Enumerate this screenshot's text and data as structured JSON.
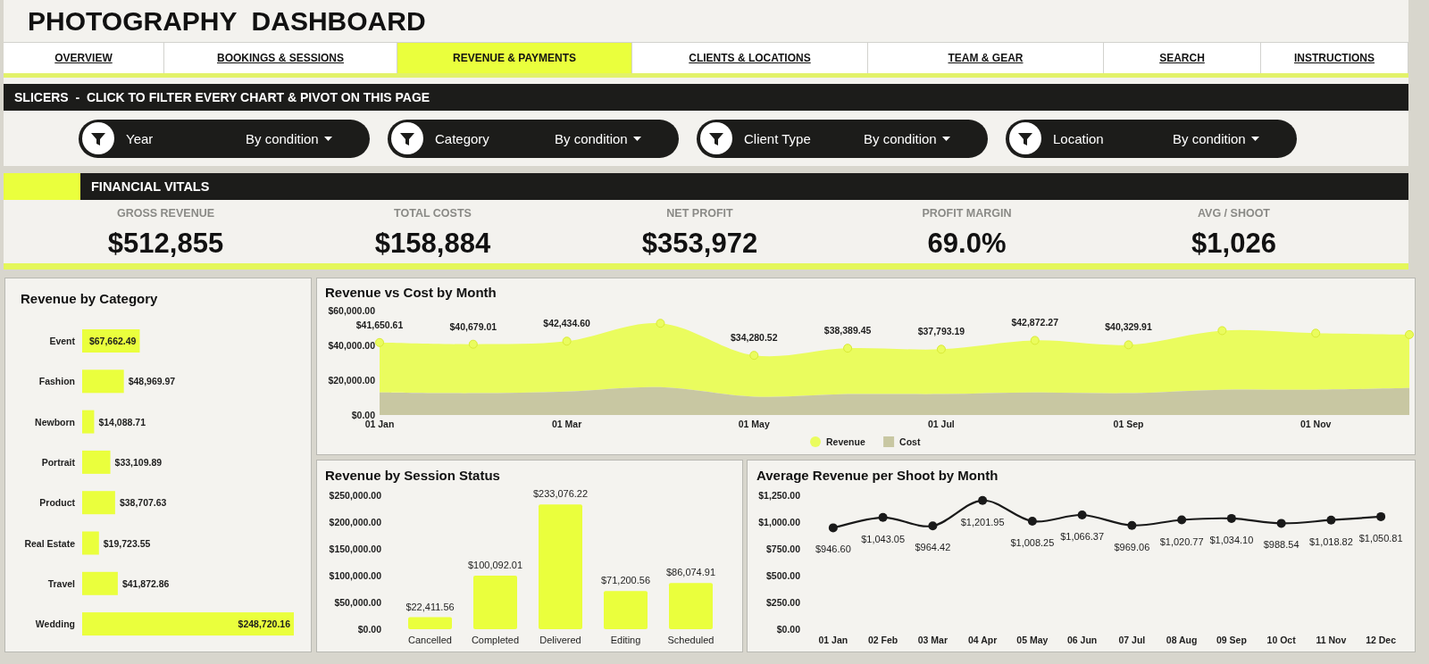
{
  "title": "PHOTOGRAPHY  DASHBOARD",
  "tabs": [
    {
      "label": "OVERVIEW",
      "selected": false
    },
    {
      "label": "BOOKINGS & SESSIONS",
      "selected": false
    },
    {
      "label": "REVENUE & PAYMENTS",
      "selected": true
    },
    {
      "label": "CLIENTS & LOCATIONS",
      "selected": false
    },
    {
      "label": "TEAM & GEAR",
      "selected": false
    },
    {
      "label": "SEARCH",
      "selected": false
    },
    {
      "label": "INSTRUCTIONS",
      "selected": false
    }
  ],
  "slicers_header": "SLICERS  -  CLICK TO FILTER EVERY CHART & PIVOT ON THIS PAGE",
  "slicers": [
    {
      "label": "Year",
      "value": "By condition"
    },
    {
      "label": "Category",
      "value": "By condition"
    },
    {
      "label": "Client Type",
      "value": "By condition"
    },
    {
      "label": "Location",
      "value": "By condition"
    }
  ],
  "financial_vitals": {
    "title": "FINANCIAL VITALS",
    "kpis": [
      {
        "label": "GROSS REVENUE",
        "value": "$512,855"
      },
      {
        "label": "TOTAL COSTS",
        "value": "$158,884"
      },
      {
        "label": "NET PROFIT",
        "value": "$353,972"
      },
      {
        "label": "PROFIT MARGIN",
        "value": "69.0%"
      },
      {
        "label": "AVG / SHOOT",
        "value": "$1,026"
      }
    ]
  },
  "revenue_by_category": {
    "title": "Revenue by Category",
    "chart_data": {
      "type": "bar",
      "orientation": "horizontal",
      "categories": [
        "Event",
        "Fashion",
        "Newborn",
        "Portrait",
        "Product",
        "Real Estate",
        "Travel",
        "Wedding"
      ],
      "values": [
        67662.49,
        48969.97,
        14088.71,
        33109.89,
        38707.63,
        19723.55,
        41872.86,
        248720.16
      ],
      "value_labels": [
        "$67,662.49",
        "$48,969.97",
        "$14,088.71",
        "$33,109.89",
        "$38,707.63",
        "$19,723.55",
        "$41,872.86",
        "$248,720.16"
      ]
    }
  },
  "revenue_vs_cost": {
    "title": "Revenue vs Cost by Month",
    "chart_data": {
      "type": "area",
      "categories": [
        "01 Jan",
        null,
        "01 Mar",
        null,
        "01 May",
        null,
        "01 Jul",
        null,
        "01 Sep",
        null,
        "01 Nov",
        null
      ],
      "ylim": [
        0,
        60000
      ],
      "yticks": [
        {
          "value": 0,
          "label": "$0.00"
        },
        {
          "value": 20000,
          "label": "$20,000.00"
        },
        {
          "value": 40000,
          "label": "$40,000.00"
        },
        {
          "value": 60000,
          "label": "$60,000.00"
        }
      ],
      "legend": "bottom",
      "series": [
        {
          "name": "Revenue",
          "color": "#eafc5e",
          "marker": "circle",
          "values": [
            41650.61,
            40679.01,
            42434.6,
            52700,
            34280.52,
            38389.45,
            37793.19,
            42872.27,
            40329.91,
            48500,
            47000,
            46200
          ],
          "value_labels": [
            "$41,650.61",
            "$40,679.01",
            "$42,434.60",
            null,
            "$34,280.52",
            "$38,389.45",
            "$37,793.19",
            "$42,872.27",
            "$40,329.91",
            null,
            null,
            null
          ]
        },
        {
          "name": "Cost",
          "color": "#c8c7a2",
          "values": [
            13000,
            12500,
            13500,
            16000,
            10500,
            12000,
            12000,
            13000,
            12500,
            14500,
            14500,
            15500
          ]
        }
      ]
    }
  },
  "revenue_by_session_status": {
    "title": "Revenue by Session Status",
    "chart_data": {
      "type": "bar",
      "categories": [
        "Cancelled",
        "Completed",
        "Delivered",
        "Editing",
        "Scheduled"
      ],
      "values": [
        22411.56,
        100092.01,
        233076.22,
        71200.56,
        86074.91
      ],
      "value_labels": [
        "$22,411.56",
        "$100,092.01",
        "$233,076.22",
        "$71,200.56",
        "$86,074.91"
      ],
      "ylim": [
        0,
        250000
      ],
      "yticks": [
        {
          "value": 0,
          "label": "$0.00"
        },
        {
          "value": 50000,
          "label": "$50,000.00"
        },
        {
          "value": 100000,
          "label": "$100,000.00"
        },
        {
          "value": 150000,
          "label": "$150,000.00"
        },
        {
          "value": 200000,
          "label": "$200,000.00"
        },
        {
          "value": 250000,
          "label": "$250,000.00"
        }
      ]
    }
  },
  "average_revenue_per_shoot": {
    "title": "Average Revenue per Shoot by Month",
    "chart_data": {
      "type": "line",
      "marker": "circle",
      "categories": [
        "01 Jan",
        "02 Feb",
        "03 Mar",
        "04 Apr",
        "05 May",
        "06 Jun",
        "07 Jul",
        "08 Aug",
        "09 Sep",
        "10 Oct",
        "11 Nov",
        "12 Dec"
      ],
      "values": [
        946.6,
        1043.05,
        964.42,
        1201.95,
        1008.25,
        1066.37,
        969.06,
        1020.77,
        1034.1,
        988.54,
        1018.82,
        1050.81
      ],
      "value_labels": [
        "$946.60",
        "$1,043.05",
        "$964.42",
        "$1,201.95",
        "$1,008.25",
        "$1,066.37",
        "$969.06",
        "$1,020.77",
        "$1,034.10",
        "$988.54",
        "$1,018.82",
        "$1,050.81"
      ],
      "ylim": [
        0,
        1250
      ],
      "yticks": [
        {
          "value": 0,
          "label": "$0.00"
        },
        {
          "value": 250,
          "label": "$250.00"
        },
        {
          "value": 500,
          "label": "$500.00"
        },
        {
          "value": 750,
          "label": "$750.00"
        },
        {
          "value": 1000,
          "label": "$1,000.00"
        },
        {
          "value": 1250,
          "label": "$1,250.00"
        }
      ]
    }
  }
}
